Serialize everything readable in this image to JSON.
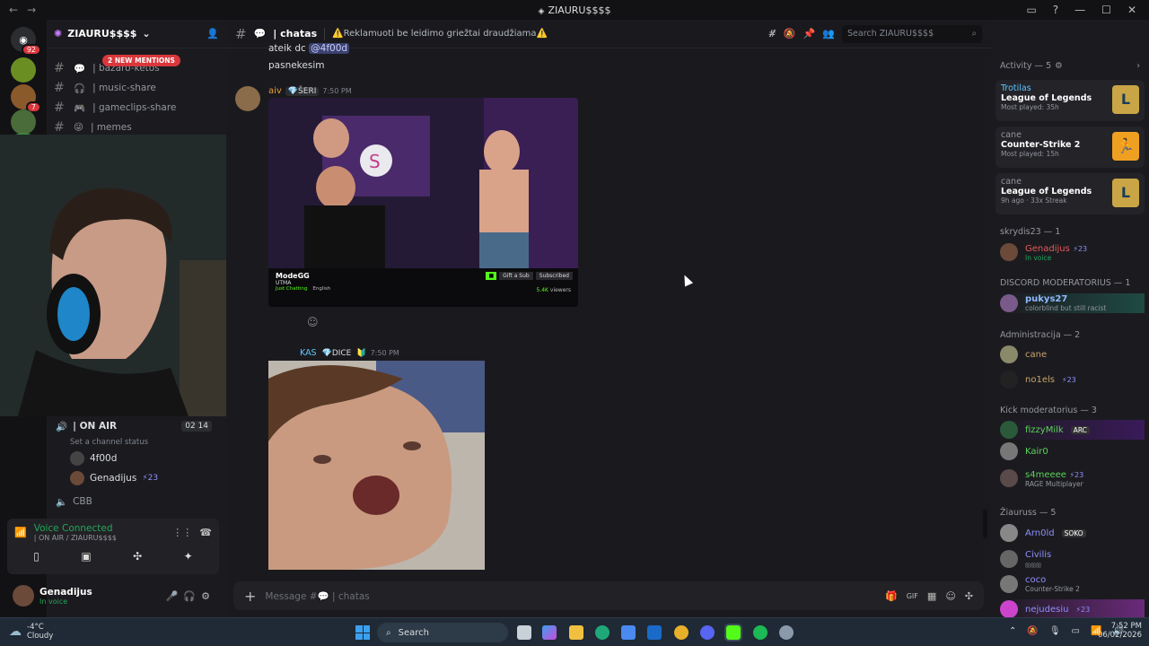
{
  "titlebar": {
    "title": "ZIAURU$$$$",
    "back": "←",
    "forward": "→",
    "min": "—",
    "max": "☐",
    "close": "✕"
  },
  "guilds": {
    "dm_badge": "92",
    "items": [
      {
        "badge": ""
      },
      {
        "badge": "7"
      },
      {
        "badge": ""
      },
      {
        "badge": "9"
      }
    ]
  },
  "server": {
    "name": "ZIAURU$$$$",
    "new_mentions": "2 NEW MENTIONS"
  },
  "channels": [
    {
      "icon": "💬",
      "label": "| chatas"
    },
    {
      "icon": "💬",
      "label": "| bazaro-ketos"
    },
    {
      "icon": "🎧",
      "label": "| music-share"
    },
    {
      "icon": "🎮",
      "label": "| gameclips-share"
    },
    {
      "icon": "😜",
      "label": "| memes"
    }
  ],
  "voice": {
    "channel": "| ON AIR",
    "count_a": "02",
    "count_b": "14",
    "status_placeholder": "Set a channel status",
    "members": [
      {
        "name": "4f00d",
        "badge": ""
      },
      {
        "name": "Genadijus",
        "badge": "⚡23"
      }
    ],
    "other_channel": "CBB",
    "connected_label": "Voice Connected",
    "connected_where": "| ON AIR / ZIAURU$$$$"
  },
  "user": {
    "name": "Genadijus",
    "status": "In voice"
  },
  "chat": {
    "channel_name": "| chatas",
    "topic": "⚠️Reklamuoti be leidimo griežtai draudžiama⚠️",
    "search_placeholder": "Search ZIAURU$$$$",
    "composer_placeholder": "Message #💬 | chatas",
    "messages": [
      {
        "author": "",
        "text_a": "ateik dc",
        "mention": "@4f00d",
        "text_b": "pasnekesim"
      },
      {
        "author": "aiv",
        "tag": "ŠERI",
        "time": "7:50 PM",
        "embed_channel": "ModeGG",
        "embed_sub": "UTMA",
        "embed_cat": "Just Chatting",
        "embed_lang": "English",
        "embed_viewers": "5.4K",
        "embed_viewers_label": "viewers",
        "btn_gift": "Gift a Sub",
        "btn_subscribed": "Subscribed",
        "live": "LIVE",
        "logo_letter": "S"
      },
      {
        "author": "KAS",
        "tag": "DICE",
        "time": "7:50 PM"
      }
    ]
  },
  "members": {
    "activity_header": "Activity — 5",
    "activities": [
      {
        "user": "Trotilas",
        "game": "League of Legends",
        "meta": "Most played: 35h"
      },
      {
        "user": "cane",
        "game": "Counter-Strike 2",
        "meta": "Most played: 15h"
      },
      {
        "user": "cane",
        "game": "League of Legends",
        "meta": "9h ago",
        "meta2": "33x Streak"
      }
    ],
    "groups": [
      {
        "title": "skrydis23 — 1",
        "members": [
          {
            "name": "Genadijus",
            "badge": "⚡23",
            "sub": "In voice",
            "color": "#e25a5a"
          }
        ]
      },
      {
        "title": "DISCORD MODERATORIUS — 1",
        "members": [
          {
            "name": "pukys27",
            "badge": "",
            "sub": "colorblind but still racist",
            "color": "#8fb8ff"
          }
        ]
      },
      {
        "title": "Administracija — 2",
        "members": [
          {
            "name": "cane",
            "badge": "",
            "sub": "",
            "color": "#c9a36b"
          },
          {
            "name": "no1els",
            "badge": "⚡23",
            "sub": "",
            "color": "#c9a36b"
          }
        ]
      },
      {
        "title": "Kick moderatorius — 3",
        "members": [
          {
            "name": "fizzyMilk",
            "badge": "ARC",
            "sub": "",
            "color": "#5ad35a"
          },
          {
            "name": "Kair0",
            "badge": "",
            "sub": "",
            "color": "#5ad35a"
          },
          {
            "name": "s4meeee",
            "badge": "⚡23",
            "sub": "RAGE Multiplayer",
            "color": "#5ad35a"
          }
        ]
      },
      {
        "title": "Žiauruss — 5",
        "members": [
          {
            "name": "Arn0ld",
            "badge": "SOKO",
            "sub": "",
            "color": "#8f8fff"
          },
          {
            "name": "Civilis",
            "badge": "",
            "sub": "ஐஐஐ",
            "color": "#8f8fff"
          },
          {
            "name": "coco",
            "badge": "",
            "sub": "Counter-Strike 2",
            "color": "#8f8fff"
          },
          {
            "name": "nejudesiu",
            "badge": "⚡23",
            "sub": "",
            "color": "#8f8fff"
          }
        ]
      }
    ]
  },
  "taskbar": {
    "weather_temp": "-4°C",
    "weather_desc": "Cloudy",
    "search": "Search",
    "time": "7:52 PM",
    "date": "06/02/2026"
  }
}
